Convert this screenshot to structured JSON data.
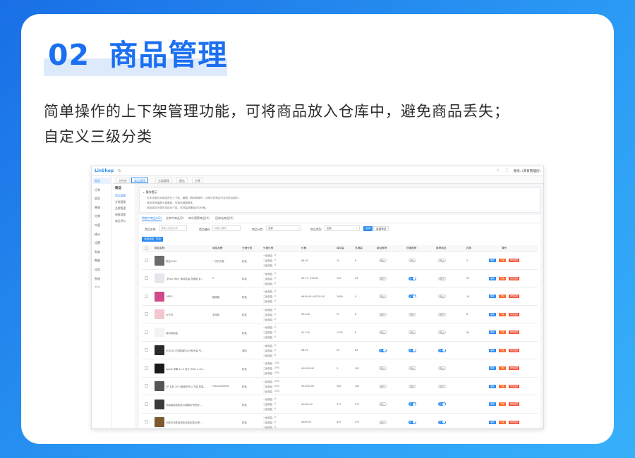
{
  "header": {
    "number": "02",
    "title": "商品管理",
    "description_line1": "简单操作的上下架管理功能，可将商品放入仓库中，避免商品丢失；",
    "description_line2": "自定义三级分类"
  },
  "app": {
    "logo": "LinShop",
    "user_label": "账号: (未有管理员)",
    "tabs": [
      "主控台",
      "商品管理",
      "分类管理",
      "报告",
      "分享"
    ],
    "nav": [
      "商品",
      "订单",
      "会员",
      "营销",
      "分销",
      "内容",
      "统计",
      "设置",
      "财务",
      "数据",
      "应用",
      "系统",
      "个人"
    ],
    "subnav_title": "商品",
    "subnav": [
      "商品管理",
      "分类管理",
      "品牌管理",
      "规格管理",
      "商品评价"
    ],
    "notice": {
      "title": "操作提示",
      "lines": [
        "· 在本页面可对商品进行上下架、编辑、删除等操作，仓库中的商品不会在前台展示。",
        "· 商品排序值越小越靠前，可拖动调整顺序。",
        "· 商品库存为零时将自动下架，可批量设置库存与价格。"
      ]
    },
    "panel_tabs": [
      "销售中商品(43)",
      "仓库中商品(2)",
      "库存预警商品(4)",
      "回收站商品(0)"
    ],
    "filters": {
      "name_label": "商品名称:",
      "name_placeholder": "请输入商品名称",
      "code_label": "商品编码:",
      "code_placeholder": "请输入编码",
      "category_label": "商品分类:",
      "category_value": "全部",
      "type_label": "商品类型:",
      "type_value": "全部",
      "search_btn": "查询",
      "reset_btn": "重置筛选"
    },
    "action_buttons": [
      "添加商品",
      "导出"
    ],
    "columns": [
      "商品名称",
      "商品品牌",
      "分销分类",
      "分销比例",
      "价格",
      "库存量",
      "总销量",
      "新品推荐",
      "热销推荐",
      "推荐商品",
      "排序",
      "操作"
    ],
    "tier_labels": [
      "一级佣金:",
      "二级佣金:",
      "三级佣金:"
    ],
    "switch_on": "是",
    "switch_off": "否",
    "row_actions": [
      "编辑",
      "下架",
      "佣金设置"
    ],
    "rows": [
      {
        "name": "新品2024",
        "brand": "一字开头款",
        "cat": "科技",
        "tiers": [
          "0",
          "0",
          "0"
        ],
        "price": "¥8.00",
        "stock": "15",
        "sales": "8",
        "new": false,
        "hot": false,
        "rec": false,
        "sort": "5",
        "thumb": "#6b6b6b"
      },
      {
        "name": "【Polo Tee】海藻放量 商家款 复...",
        "brand": "9",
        "cat": "科技",
        "tiers": [
          "0",
          "0",
          "0"
        ],
        "price": "¥0.75~¥30.00",
        "stock": "198",
        "sales": "34",
        "new": false,
        "hot": true,
        "rec": false,
        "sort": "20",
        "thumb": "#e6e6ec"
      },
      {
        "name": "OPPO",
        "brand": "魅闻能",
        "cat": "科技",
        "tiers": [
          "0",
          "0",
          "0"
        ],
        "price": "¥999.00~¥1500.00",
        "stock": "2989",
        "sales": "9",
        "new": false,
        "hot": true,
        "rec": false,
        "sort": "10",
        "thumb": "#d04a8a"
      },
      {
        "name": "大卡鸟",
        "brand": "全球帆",
        "cat": "科技",
        "tiers": [
          "0",
          "0",
          "0"
        ],
        "price": "¥24.00",
        "stock": "51",
        "sales": "8",
        "new": false,
        "hot": false,
        "rec": false,
        "sort": "8",
        "thumb": "#f1c7d0"
      },
      {
        "name": "耳机收纳盒",
        "brand": "",
        "cat": "科技",
        "tiers": [
          "0",
          "0",
          "0"
        ],
        "price": "¥11.00",
        "stock": "1190",
        "sales": "8",
        "new": false,
        "hot": false,
        "rec": false,
        "sort": "99",
        "thumb": "#f3f3f3"
      },
      {
        "name": "VOGUE 白领制服2019秋冬装 气...",
        "brand": "",
        "cat": "潮流",
        "tiers": [
          "0",
          "0",
          "0"
        ],
        "price": "¥8.01",
        "stock": "93",
        "sales": "84",
        "new": true,
        "hot": true,
        "rec": true,
        "sort": "",
        "thumb": "#2a2a2a"
      },
      {
        "name": "Apple 苹果 21.5 英寸 iMac 2.3G...",
        "brand": "",
        "cat": "科技",
        "tiers": [
          "10%",
          "20%",
          "10%"
        ],
        "price": "¥10000.00",
        "stock": "3",
        "sales": "500",
        "new": false,
        "hot": false,
        "rec": false,
        "sort": "",
        "thumb": "#1a1a1a"
      },
      {
        "name": "SP 名利 2019新款外衣上下装 男装...",
        "brand": "FashionBlanes",
        "cat": "科技",
        "tiers": [
          "20%",
          "20%",
          "15%"
        ],
        "price": "¥12000.00",
        "stock": "288",
        "sales": "443",
        "new": false,
        "hot": false,
        "rec": false,
        "sort": "",
        "thumb": "#555555"
      },
      {
        "name": "包装袋铝箔制品 机器袋子标签牛...",
        "brand": "",
        "cat": "科技",
        "tiers": [
          "0",
          "0",
          "0"
        ],
        "price": "¥1900.00",
        "stock": "377",
        "sales": "379",
        "new": false,
        "hot": true,
        "rec": true,
        "sort": "",
        "thumb": "#3a3a3a"
      },
      {
        "name": "长款中长款高领毛衣连衣裙 秋冬...",
        "brand": "",
        "cat": "科技",
        "tiers": [
          "0",
          "0",
          "0"
        ],
        "price": "¥389.00",
        "stock": "439",
        "sales": "473",
        "new": false,
        "hot": true,
        "rec": true,
        "sort": "",
        "thumb": "#7a5a2e"
      }
    ]
  }
}
